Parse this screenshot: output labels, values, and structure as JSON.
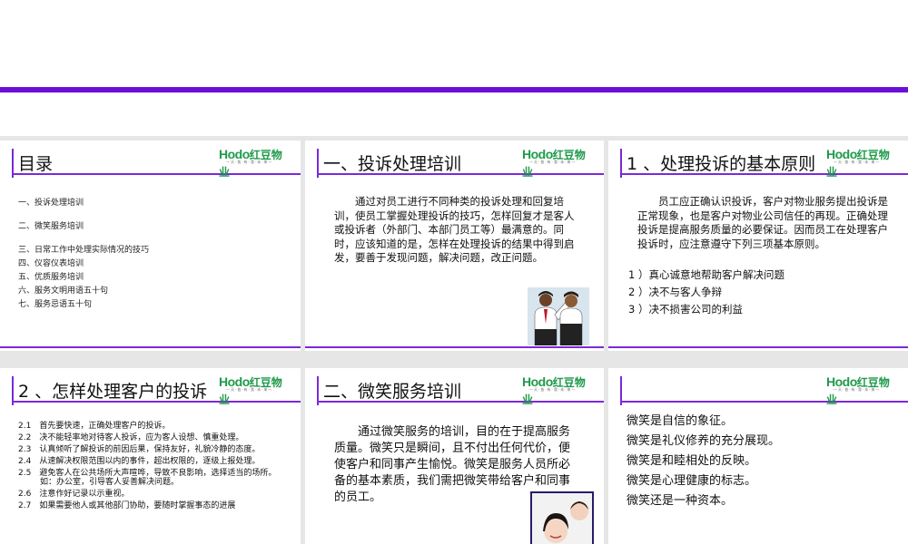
{
  "logo": {
    "mark": "Hodo",
    "name": "红豆物业",
    "tagline": "—天·皆·有·我·未·来—"
  },
  "slides": {
    "s1": {
      "title": "目录",
      "items": [
        "一、投诉处理培训",
        "二、微笑服务培训",
        "三、日常工作中处理实际情况的技巧",
        "四、仪容仪表培训",
        "五、优质服务培训",
        "六、服务文明用语五十句",
        "七、服务忌语五十句"
      ]
    },
    "s2": {
      "title": "一、投诉处理培训",
      "body": "　　通过对员工进行不同种类的投诉处理和回复培训，使员工掌握处理投诉的技巧，怎样回复才是客人或投诉者（外部门、本部门员工等）最满意的。同时，应该知道的是，怎样在处理投诉的结果中得到启发，要善于发现问题，解决问题，改正问题。"
    },
    "s3": {
      "title": "1 、处理投诉的基本原则",
      "body": "　　员工应正确认识投诉，客户对物业服务提出投诉是正常现象，也是客户对物业公司信任的再现。正确处理投诉是提高服务质量的必要保证。因而员工在处理客户投诉时，应注意遵守下列三项基本原则。",
      "items": [
        "1 ）真心诚意地帮助客户解决问题",
        "2 ）决不与客人争辩",
        "3 ）决不损害公司的利益"
      ]
    },
    "s4": {
      "title": "2 、怎样处理客户的投诉",
      "items": [
        "2.1　首先要快速，正确处理客户的投诉。",
        "2.2　决不能轻率地对待客人投诉，应为客人设想、慎重处理。",
        "2.3　认真倾听了解投诉的前因后果，保持友好，礼貌冷静的态度。",
        "2.4　从速解决权限范围以内的事件，超出权限的，逐级上报处理。",
        "2.5　避免客人在公共场所大声喧哗，导致不良影响，选择适当的场所。如：办公室，引导客人妥善解决问题。",
        "2.6　注意作好记录以示重视。",
        "2.7　如果需要他人或其他部门协助，要随时掌握事态的进展"
      ]
    },
    "s5": {
      "title": "二、微笑服务培训",
      "body": "　　通过微笑服务的培训，目的在于提高服务质量。微笑只是瞬间，且不付出任何代价，便使客户和同事产生愉悦。微笑是服务人员所必备的基本素质，我们需把微笑带给客户和同事的员工。"
    },
    "s6": {
      "items": [
        "微笑是自信的象征。",
        "微笑是礼仪修养的充分展现。",
        "微笑是和睦相处的反映。",
        "微笑是心理健康的标志。",
        "微笑还是一种资本。"
      ]
    }
  }
}
